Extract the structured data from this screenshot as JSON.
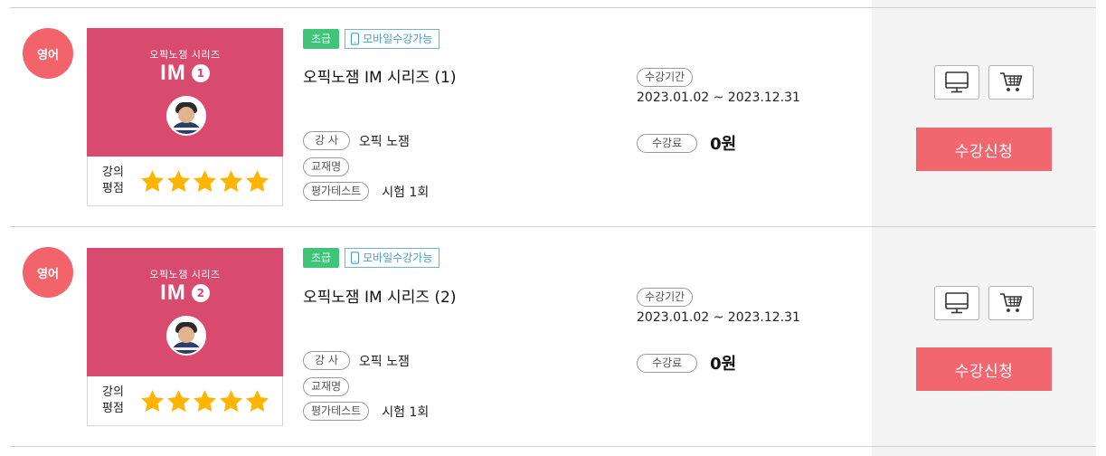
{
  "courses": [
    {
      "language": "영어",
      "thumb_series": "오픽노잼 시리즈",
      "thumb_main": "IM",
      "thumb_number": "1",
      "rating_label_1": "강의",
      "rating_label_2": "평점",
      "rating": 5,
      "level": "초급",
      "mobile": "모바일수강가능",
      "title": "오픽노잼 IM 시리즈 (1)",
      "instructor_label": "강 사",
      "instructor": "오픽 노잼",
      "textbook_label": "교재명",
      "textbook": "",
      "test_label": "평가테스트",
      "test": "시험 1회",
      "period_label": "수강기간",
      "period": "2023.01.02 ~ 2023.12.31",
      "fee_label": "수강료",
      "fee": "0원",
      "enroll_label": "수강신청"
    },
    {
      "language": "영어",
      "thumb_series": "오픽노잼 시리즈",
      "thumb_main": "IM",
      "thumb_number": "2",
      "rating_label_1": "강의",
      "rating_label_2": "평점",
      "rating": 5,
      "level": "초급",
      "mobile": "모바일수강가능",
      "title": "오픽노잼 IM 시리즈 (2)",
      "instructor_label": "강 사",
      "instructor": "오픽 노잼",
      "textbook_label": "교재명",
      "textbook": "",
      "test_label": "평가테스트",
      "test": "시험 1회",
      "period_label": "수강기간",
      "period": "2023.01.02 ~ 2023.12.31",
      "fee_label": "수강료",
      "fee": "0원",
      "enroll_label": "수강신청"
    }
  ],
  "icons": {
    "sample": "monitor-icon",
    "cart": "cart-icon",
    "star": "star-icon",
    "mobile": "mobile-phone-icon"
  },
  "colors": {
    "accent": "#f2636b",
    "thumb": "#d84a6e",
    "level": "#3fc47a",
    "star": "#ffb400",
    "side_panel": "#f4f4f4"
  }
}
